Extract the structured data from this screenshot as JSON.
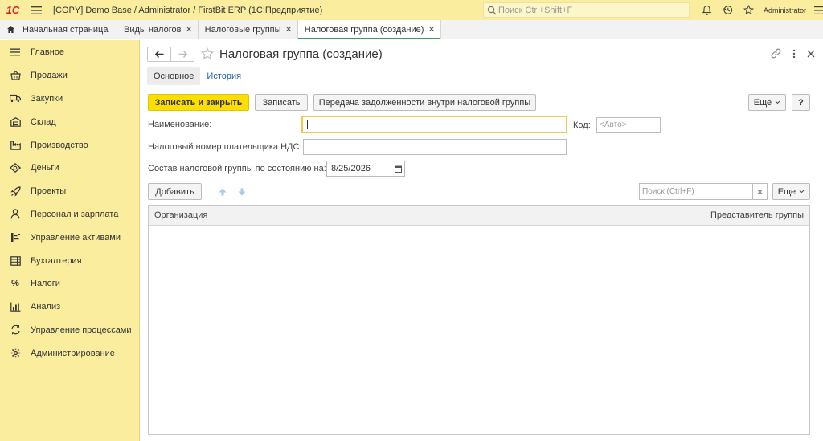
{
  "topbar": {
    "logo": "1С",
    "title": "[COPY] Demo Base / Administrator / FirstBit ERP  (1С:Предприятие)",
    "search_placeholder": "Поиск Ctrl+Shift+F",
    "user": "Administrator"
  },
  "tabs": [
    {
      "label": "Начальная страница"
    },
    {
      "label": "Виды налогов"
    },
    {
      "label": "Налоговые группы"
    },
    {
      "label": "Налоговая группа (создание)"
    }
  ],
  "sidebar": {
    "items": [
      {
        "label": "Главное",
        "icon": "menu-icon"
      },
      {
        "label": "Продажи",
        "icon": "basket-icon"
      },
      {
        "label": "Закупки",
        "icon": "truck-icon"
      },
      {
        "label": "Склад",
        "icon": "warehouse-icon"
      },
      {
        "label": "Производство",
        "icon": "factory-icon"
      },
      {
        "label": "Деньги",
        "icon": "money-icon"
      },
      {
        "label": "Проекты",
        "icon": "rocket-icon"
      },
      {
        "label": "Персонал и зарплата",
        "icon": "person-icon"
      },
      {
        "label": "Управление активами",
        "icon": "assets-icon"
      },
      {
        "label": "Бухгалтерия",
        "icon": "ledger-icon"
      },
      {
        "label": "Налоги",
        "icon": "percent-icon"
      },
      {
        "label": "Анализ",
        "icon": "chart-icon"
      },
      {
        "label": "Управление процессами",
        "icon": "process-icon"
      },
      {
        "label": "Администрирование",
        "icon": "gear-icon"
      }
    ]
  },
  "form": {
    "title": "Налоговая группа (создание)",
    "subtabs": {
      "main": "Основное",
      "history": "История"
    },
    "buttons": {
      "save_close": "Записать и закрыть",
      "save": "Записать",
      "transfer": "Передача задолженности внутри налоговой группы",
      "more": "Еще",
      "help": "?",
      "add": "Добавить",
      "more2": "Еще",
      "clear": "×"
    },
    "fields": {
      "name_label": "Наименование:",
      "code_label": "Код:",
      "code_placeholder": "<Авто>",
      "vat_label": "Налоговый номер плательщика НДС:",
      "date_label": "Состав налоговой группы по состоянию на:",
      "date_value": "8/25/2026",
      "search_placeholder": "Поиск (Ctrl+F)"
    },
    "table": {
      "columns": [
        "Организация",
        "Представитель группы"
      ],
      "rows": []
    }
  },
  "colors": {
    "accent_yellow": "#fbed9e",
    "primary_button": "#fcdf00",
    "active_tab_underline": "#3d9b5c",
    "link": "#1f5fa8"
  }
}
